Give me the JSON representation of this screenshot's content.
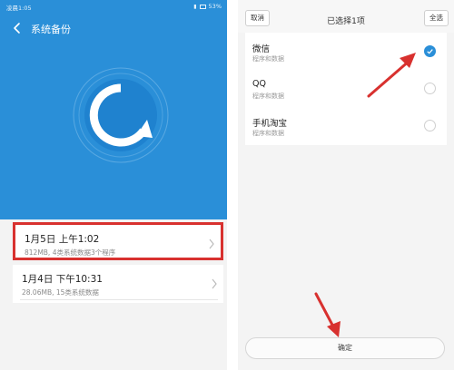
{
  "left_screen": {
    "status": {
      "left_text": "凌晨1:05",
      "battery_text": "53%"
    },
    "title": "系统备份",
    "backups": [
      {
        "title": "1月5日 上午1:02",
        "subtitle": "812MB, 4类系统数据3个程序",
        "highlighted": true
      },
      {
        "title": "1月4日 下午10:31",
        "subtitle": "28.06MB, 15类系统数据",
        "highlighted": false
      }
    ]
  },
  "right_screen": {
    "cancel_label": "取消",
    "title": "已选择1项",
    "select_all_label": "全选",
    "apps": [
      {
        "name": "微信",
        "desc": "程序和数据",
        "checked": true
      },
      {
        "name": "QQ",
        "desc": "程序和数据",
        "checked": false
      },
      {
        "name": "手机淘宝",
        "desc": "程序和数据",
        "checked": false
      }
    ],
    "confirm_label": "确定"
  },
  "colors": {
    "primary": "#2a8fd8",
    "highlight": "#d8312f",
    "annotation_arrow": "#d8312f"
  }
}
